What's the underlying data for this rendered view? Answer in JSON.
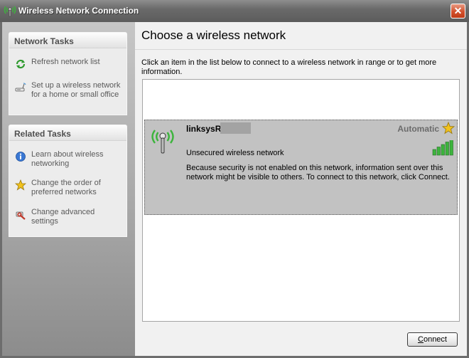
{
  "window": {
    "title": "Wireless Network Connection",
    "close_glyph": "✕"
  },
  "network_tasks": {
    "header": "Network Tasks",
    "items": [
      {
        "label": "Refresh network list",
        "icon": "refresh-icon"
      },
      {
        "label": "Set up a wireless network for a home or small office",
        "icon": "wireless-setup-icon"
      }
    ]
  },
  "related_tasks": {
    "header": "Related Tasks",
    "items": [
      {
        "label": "Learn about wireless networking",
        "icon": "info-icon"
      },
      {
        "label": "Change the order of preferred networks",
        "icon": "star-icon"
      },
      {
        "label": "Change advanced settings",
        "icon": "wrench-icon"
      }
    ]
  },
  "main": {
    "heading": "Choose a wireless network",
    "intro": "Click an item in the list below to connect to a wireless network in range or to get more information."
  },
  "network": {
    "name": "linksysR",
    "connection_mode": "Automatic",
    "security_status": "Unsecured wireless network",
    "signal_bars": 5,
    "signal_max": 5,
    "warning": "Because security is not enabled on this network, information sent over this network might be visible to others. To connect to this network, click Connect."
  },
  "buttons": {
    "connect_prefix": "",
    "connect_accel": "C",
    "connect_rest": "onnect"
  },
  "colors": {
    "signal_green": "#3cb43c",
    "star_gold": "#f2c21b",
    "close_red": "#d2502c"
  }
}
